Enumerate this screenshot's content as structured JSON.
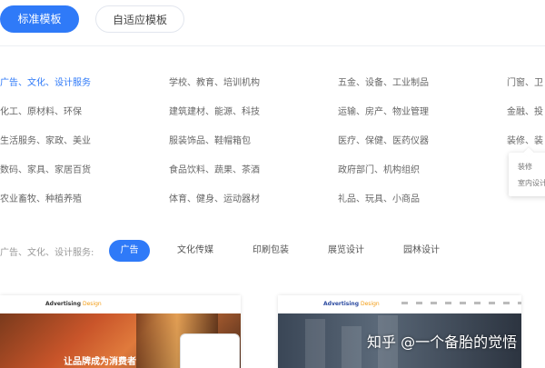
{
  "top_tabs": [
    {
      "label": "标准模板"
    },
    {
      "label": "自适应模板"
    }
  ],
  "categories": [
    [
      "广告、文化、设计服务",
      "学校、教育、培训机构",
      "五金、设备、工业制品",
      "门窗、卫"
    ],
    [
      "化工、原材料、环保",
      "建筑建材、能源、科技",
      "运输、房产、物业管理",
      "金融、投"
    ],
    [
      "生活服务、家政、美业",
      "服装饰品、鞋帽箱包",
      "医疗、保健、医药仪器",
      "装修、装"
    ],
    [
      "数码、家具、家居百货",
      "食品饮料、蔬果、茶酒",
      "政府部门、机构组织",
      ""
    ],
    [
      "农业畜牧、种植养殖",
      "体育、健身、运动器材",
      "礼品、玩具、小商品",
      ""
    ]
  ],
  "popover": {
    "items": [
      "装修",
      "室内设计"
    ]
  },
  "sub_filter": {
    "label": "广告、文化、设计服务:",
    "tabs": [
      "广告",
      "文化传媒",
      "印刷包装",
      "展览设计",
      "园林设计"
    ]
  },
  "cards": {
    "left": {
      "logo": "Advertising",
      "logo_sub": "Design",
      "slogan": "让品牌成为消费者"
    },
    "right": {
      "logo": "Advertising",
      "logo_sub": "Design"
    }
  },
  "watermark": "知乎 @一个备胎的觉悟",
  "colors": {
    "accent": "#2f7af8"
  }
}
